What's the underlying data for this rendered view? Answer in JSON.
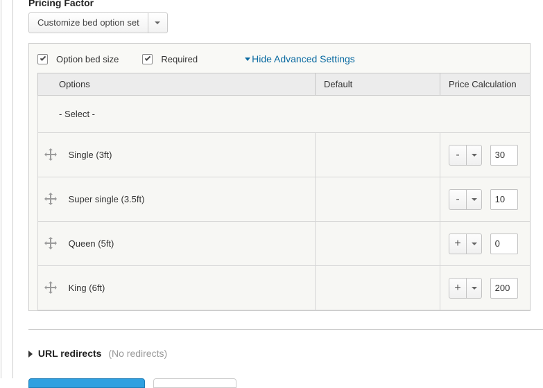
{
  "heading": "Pricing Factor",
  "factor_select": {
    "value": "Customize bed option set"
  },
  "option": {
    "size_checked": true,
    "size_label": "Option bed size",
    "required_checked": true,
    "required_label": "Required",
    "advanced_link": "Hide Advanced Settings"
  },
  "columns": {
    "options": "Options",
    "default": "Default",
    "price_calc": "Price Calculation"
  },
  "rows": [
    {
      "label": "- Select -",
      "is_placeholder": true
    },
    {
      "label": "Single (3ft)",
      "op": "-",
      "amount": "30"
    },
    {
      "label": "Super single (3.5ft)",
      "op": "-",
      "amount": "10"
    },
    {
      "label": "Queen (5ft)",
      "op": "+",
      "amount": "0"
    },
    {
      "label": "King (6ft)",
      "op": "+",
      "amount": "200"
    }
  ],
  "url_section": {
    "label": "URL redirects",
    "hint": "(No redirects)"
  }
}
